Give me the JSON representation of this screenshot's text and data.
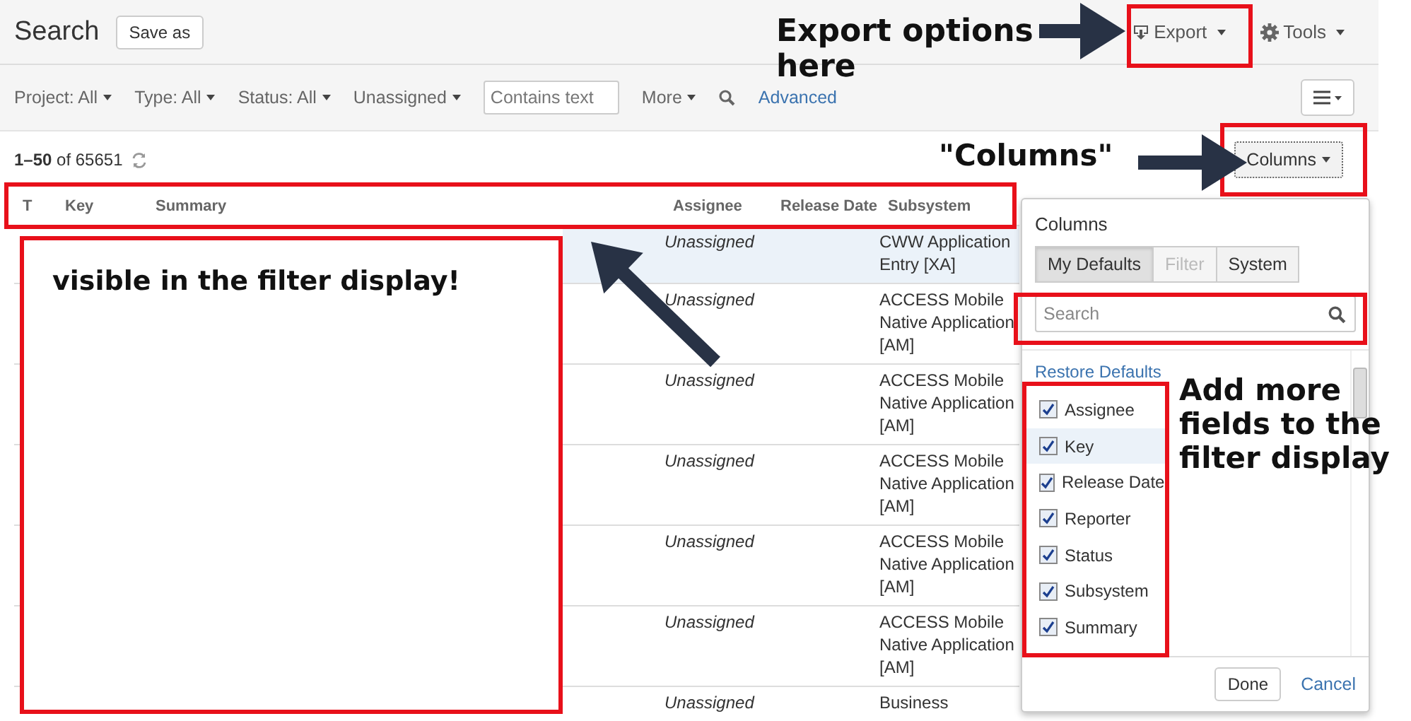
{
  "header": {
    "title": "Search",
    "save_button": "Save as",
    "export": "Export",
    "tools": "Tools"
  },
  "filters": [
    {
      "label": "Project: All"
    },
    {
      "label": "Type: All"
    },
    {
      "label": "Status: All"
    },
    {
      "label": "Unassigned"
    }
  ],
  "text_filter": {
    "placeholder": "Contains text"
  },
  "more": "More",
  "advanced": "Advanced",
  "results": {
    "count": "**1–50** of 65651",
    "columns_button": "Columns"
  },
  "table": {
    "columns": [
      "T",
      "Key",
      "Summary",
      "Assignee",
      "Release Date",
      "Subsystem"
    ],
    "rows": [
      {
        "assignee": "Unassigned",
        "subsystem": "CWW Application Entry [XA]",
        "selected": true
      },
      {
        "assignee": "Unassigned",
        "subsystem": "ACCESS Mobile Native Application [AM]",
        "selected": false
      },
      {
        "assignee": "Unassigned",
        "subsystem": "ACCESS Mobile Native Application [AM]",
        "selected": false
      },
      {
        "assignee": "Unassigned",
        "subsystem": "ACCESS Mobile Native Application [AM]",
        "selected": false
      },
      {
        "assignee": "Unassigned",
        "subsystem": "ACCESS Mobile Native Application [AM]",
        "selected": false
      },
      {
        "assignee": "Unassigned",
        "subsystem": "ACCESS Mobile Native Application [AM]",
        "selected": false
      },
      {
        "assignee": "Unassigned",
        "subsystem": "Business",
        "selected": false
      }
    ]
  },
  "columns_popup": {
    "title": "Columns",
    "tabs": [
      {
        "label": "My Defaults",
        "selected": true,
        "disabled": false
      },
      {
        "label": "Filter",
        "selected": false,
        "disabled": true
      },
      {
        "label": "System",
        "selected": false,
        "disabled": false
      }
    ],
    "search": {
      "placeholder": "Search"
    },
    "restore": "Restore Defaults",
    "fields": [
      {
        "label": "Assignee",
        "checked": true,
        "selected": false
      },
      {
        "label": "Key",
        "checked": true,
        "selected": true
      },
      {
        "label": "Release Date",
        "checked": true,
        "selected": false
      },
      {
        "label": "Reporter",
        "checked": true,
        "selected": false
      },
      {
        "label": "Status",
        "checked": true,
        "selected": false
      },
      {
        "label": "Subsystem",
        "checked": true,
        "selected": false
      },
      {
        "label": "Summary",
        "checked": true,
        "selected": false
      }
    ],
    "done": "Done",
    "cancel": "Cancel"
  },
  "annotations": [
    "Export options here",
    "\"Columns\"",
    "visible in the filter display!",
    "Add more fields to the filter display"
  ]
}
